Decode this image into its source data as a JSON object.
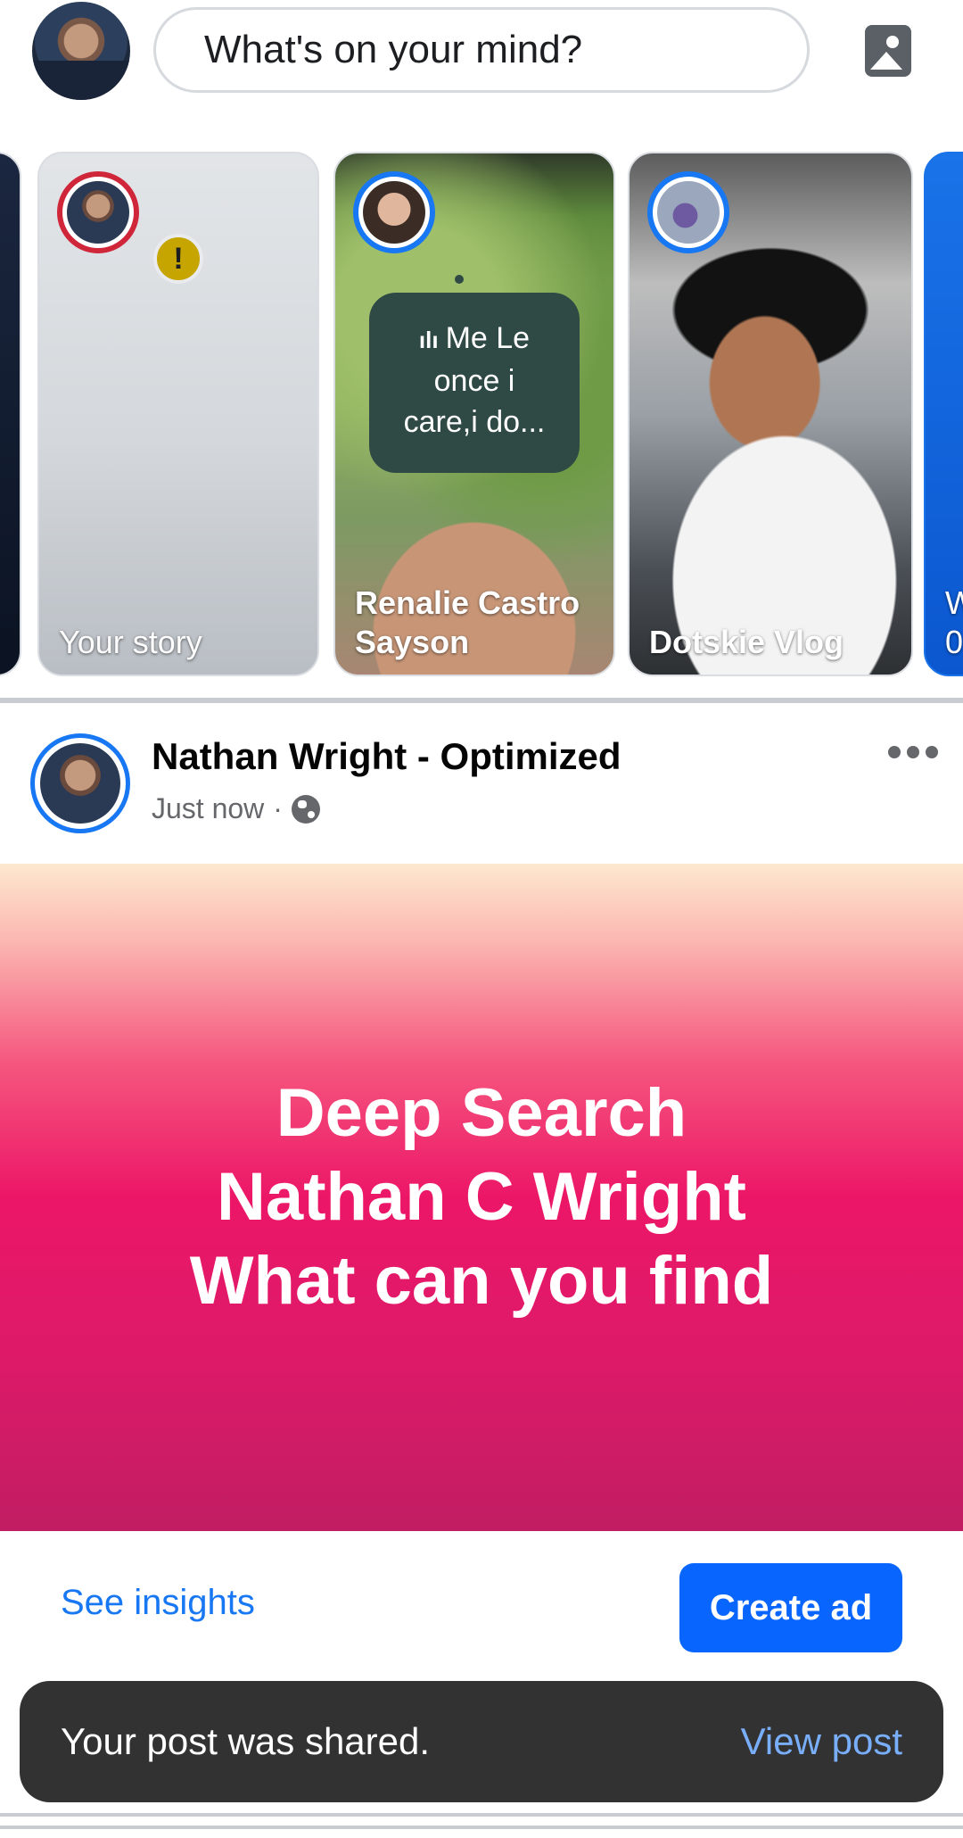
{
  "composer": {
    "placeholder": "What's on your mind?",
    "photo_icon": "photo-icon"
  },
  "stories": [
    {
      "label": "",
      "kind": "partial-left"
    },
    {
      "label": "Your story",
      "badge": "!"
    },
    {
      "label": "Renalie Castro Sayson",
      "voice_text_line1": "Me   Le",
      "voice_text_line2": "once i",
      "voice_text_line3": "care,i do..."
    },
    {
      "label": "Dotskie Vlog"
    },
    {
      "label": "W 0",
      "kind": "partial-right"
    }
  ],
  "post": {
    "author": "Nathan Wright - Optimized",
    "time": "Just now",
    "separator": "·",
    "privacy_icon": "globe-icon",
    "text_lines": [
      "Deep Search",
      "Nathan C Wright",
      "What can you find"
    ],
    "background_colors": [
      "#fde8cf",
      "#ec1667",
      "#c11d63"
    ]
  },
  "actions": {
    "insights": "See insights",
    "create_ad": "Create ad"
  },
  "snackbar": {
    "message": "Your post was shared.",
    "action": "View post"
  },
  "colors": {
    "accent": "#1877f2",
    "button": "#0866ff",
    "snackbar_bg": "#323233",
    "snackbar_link": "#79aefb"
  }
}
